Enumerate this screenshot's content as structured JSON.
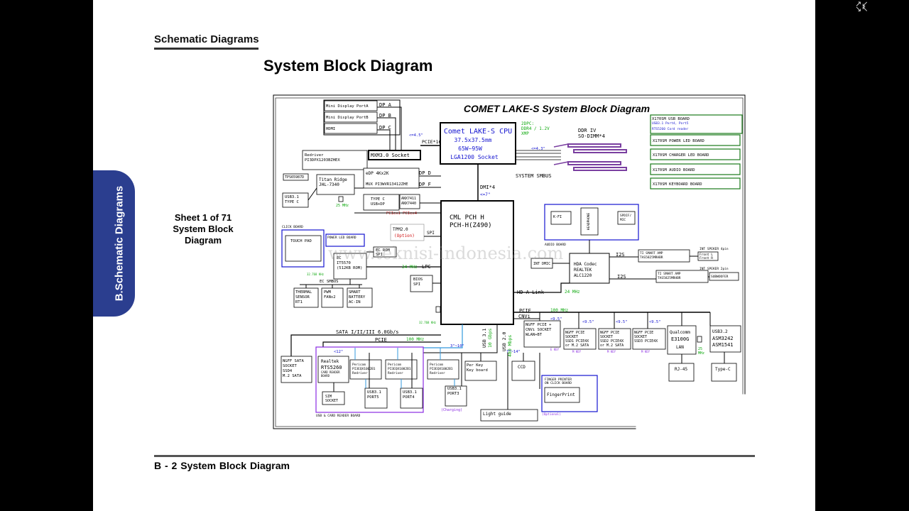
{
  "viewer": {
    "exit_fullscreen_icon": "collapse-arrows-icon"
  },
  "page": {
    "section_header": "Schematic  Diagrams",
    "title": "System Block Diagram",
    "side_tab": "B.Schematic Diagrams",
    "sheet_info": [
      "Sheet 1 of 71",
      "System Block",
      "Diagram"
    ],
    "footer": "B - 2   System Block Diagram"
  },
  "diagram": {
    "main_title": "COMET LAKE-S System Block Diagram",
    "watermark": "www.teknisi-indonesia.com",
    "colors": {
      "blue": "#1515d0",
      "green": "#11aa11",
      "red": "#d01515",
      "purple": "#8a2be2",
      "dimm": "#7a3fa0"
    },
    "cpu": [
      "Comet LAKE-S CPU",
      "37.5x37.5mm",
      "65W~95W",
      "LGA1200 Socket"
    ],
    "pch": [
      "CML PCH H",
      "PCH-H(Z490)"
    ],
    "display_ports": [
      "Mini Display PortA",
      "Mini Display PortB",
      "HDMI"
    ],
    "dp_labels": [
      "DP A",
      "DP B",
      "DP C",
      "DP D",
      "DP F"
    ],
    "mxm": "MXM3.0 Socket",
    "pcie16": "PCIE*16",
    "len_4_5": "<=4.5\"",
    "len_4_3": "<=4.3\"",
    "len_7": "<=7\"",
    "dmi": "DMI*4",
    "ddr_spec": [
      "2DPC:",
      "DDR4 / 1.2V",
      "XMP"
    ],
    "ddr": [
      "DDR IV",
      "SO-DIMM*4"
    ],
    "system_smbus": "SYSTEM SMBUS",
    "redriver": [
      "Redriver",
      "PI3DPX1203BZHEX"
    ],
    "tps": "TPS65987D",
    "titan": [
      "Titan Ridge",
      "JHL-7340"
    ],
    "usb31_typec": [
      "USB3.1",
      "TYPE C"
    ],
    "mhz25": "25 MHz",
    "edp": "eDP 4Kx2K",
    "mux": "MUX PI3WVR13412ZHE",
    "typec_dp": [
      "TYPE C",
      "USB+DP"
    ],
    "anx": [
      "ANX7411",
      "ANX7440"
    ],
    "pcie_x4": "PCIex1~PCIex4",
    "boards": [
      "X170SM USB BOARD",
      "USB3.1 Port4, Port5",
      "RTS5260 Card reader",
      "X170SM POWER LED BOARD",
      "X170SM CHARGER LED BOARD",
      "X170SM AUDIO BOARD",
      "X170SM KEYBOARD BOARD"
    ],
    "audio": [
      "K-FI",
      "HEADPHONE",
      "SPDIF/ MIC",
      "AUDIO BOARD"
    ],
    "tpm": [
      "TPM2.0",
      "(Option)"
    ],
    "spi": "SPI",
    "click_board": "CLICK BOARD",
    "touch_pad": "TOUCH PAD",
    "power_led_board": "POWER LED BOARD",
    "ec": [
      "EC",
      "IT5570",
      "(512KB ROM)"
    ],
    "ec_rom": [
      "EC ROM",
      "SPI"
    ],
    "mhz24": "24 MHz",
    "lpc": "LPC",
    "khz": "32.768 KHz",
    "bios": [
      "BIOS",
      "SPI"
    ],
    "ec_smbus": "EC SMBUS",
    "thermal": [
      "THERMAL",
      "SENSOR",
      "RT1"
    ],
    "pwm": [
      "PWM",
      "FANx2"
    ],
    "battery": [
      "SMART",
      "BATTERY",
      "AC-IN"
    ],
    "int_dmic": "INT DMIC",
    "hda_codec": [
      "HDA Codec",
      "REALTEK",
      "ALC1220"
    ],
    "i2s": "I2S",
    "amp": [
      "TI SMART AMP",
      "TAS5825MRHBR"
    ],
    "front": [
      "Front L",
      "Front R"
    ],
    "int_speaker": "INT SPEKER 4pin",
    "int_speaker2": "INT SPEKER 2pin",
    "subwoofer": "SUBWOOFER",
    "hda_link": "HD-A Link",
    "pcie_label": "PCIE",
    "mhz100": "100 MHz",
    "cnvi": "CNVi",
    "len_9_5": "<9.5\"",
    "ngff_wlan": [
      "NGFF PCIE +",
      "CNVi SOCKET",
      "WLAN+BT"
    ],
    "e_key": "E KEY",
    "m_key": "M KEY",
    "ssd1": [
      "NGFF PCIE",
      "SOCKET",
      "SSD1 PCIE4X",
      "or M.2 SATA"
    ],
    "ssd2": [
      "NGFF PCIE",
      "SOCKET",
      "SSD2 PCIE4X",
      "or M.2 SATA"
    ],
    "ssd3": [
      "NGFF PCIE",
      "SOCKET",
      "SSD3 PCIE4X"
    ],
    "lan": [
      "Qualcomm",
      "E3100G",
      "LAN"
    ],
    "rj45": "RJ-45",
    "asm": [
      "USB3.2",
      "ASM3242",
      "ASM1541"
    ],
    "typec2": "Type-C",
    "sata": "SATA I/II/III 6.0Gb/s",
    "usb31_10g": [
      "USB 3.1",
      "10 Gbps"
    ],
    "usb20_480m": [
      "USB 2.0",
      "480 Mbps"
    ],
    "len_3_10": "3\"~10\"",
    "len_12": "<12\"",
    "len_7_14": "7\"~14\"",
    "ngff_sata": [
      "NGFF SATA",
      "SOCKET",
      "SSD4",
      "M.2 SATA"
    ],
    "realtek": [
      "Realtek",
      "RTS5260",
      "CARD READER",
      "BOARD"
    ],
    "pericom1": [
      "Pericom",
      "PI3EQX1002B1",
      "Redriver"
    ],
    "pericom2": [
      "Pericom",
      "PI3EQX1002B1",
      "Redriver"
    ],
    "pericom3": [
      "Pericom",
      "PI3EQX1002B1",
      "Redriver"
    ],
    "sim": [
      "SIM",
      "SOCKET"
    ],
    "port5": [
      "USB3.1",
      "PORT5"
    ],
    "port4": [
      "USB3.1",
      "PORT4"
    ],
    "port3": [
      "USB3.1",
      "PORT3"
    ],
    "charging": "(Charging)",
    "perkey": [
      "Per Key",
      "Key board"
    ],
    "ccd": "CCD",
    "finger": [
      "FINGER PRINTER",
      "ON CLICK BOARD",
      "FingerPrint",
      "(Optional)"
    ],
    "light_guide": "Light guide",
    "usb_card_board": "USB & CARD READER BOARD"
  }
}
